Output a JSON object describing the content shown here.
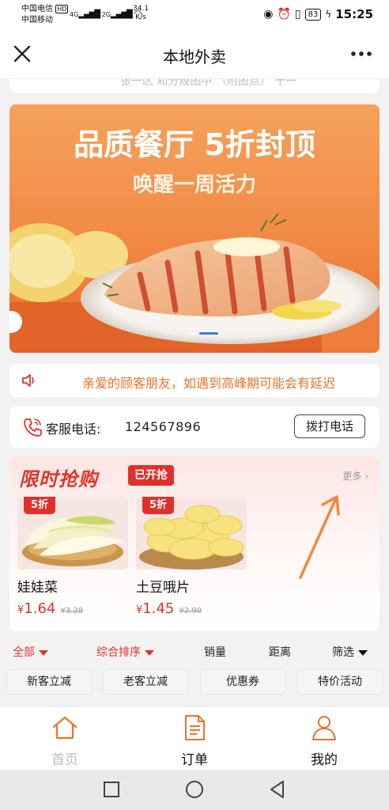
{
  "status_bar": {
    "carrier_1": "中国电信",
    "hd_badge": "HD",
    "carrier_2": "中国移动",
    "net_1": "4G",
    "net_2": "2G",
    "speed_value": "34.1",
    "speed_unit": "K/s",
    "battery": "83",
    "time": "15:25"
  },
  "nav": {
    "title": "本地外卖"
  },
  "cutoff_text": "张一区 和分规图中 （附图点） 十一",
  "banner": {
    "headline": "品质餐厅 5折封顶",
    "subline": "唤醒一周活力",
    "accent_color": "#f07a3c"
  },
  "notice": {
    "text": "亲爱的顾客朋友，如遇到高峰期可能会有延迟"
  },
  "service": {
    "label": "客服电话:",
    "number": "124567896",
    "call_button": "拨打电话"
  },
  "flash_sale": {
    "title": "限时抢购",
    "badge": "已开抢",
    "more": "更多",
    "products": [
      {
        "name": "娃娃菜",
        "discount": "5折",
        "currency": "¥",
        "price": "1.64",
        "old_price": "¥3.28"
      },
      {
        "name": "土豆哦片",
        "discount": "5折",
        "currency": "¥",
        "price": "1.45",
        "old_price": "¥2.90"
      }
    ]
  },
  "filters": {
    "all": "全部",
    "sort": "综合排序",
    "sales": "销量",
    "distance": "距离",
    "filter": "筛选"
  },
  "chips": [
    "新客立减",
    "老客立减",
    "优惠券",
    "特价活动"
  ],
  "tabs": [
    {
      "label": "首页",
      "icon": "home-icon"
    },
    {
      "label": "订单",
      "icon": "order-icon"
    },
    {
      "label": "我的",
      "icon": "profile-icon"
    }
  ],
  "colors": {
    "brand_red": "#e1352a",
    "brand_orange": "#e8732a"
  }
}
